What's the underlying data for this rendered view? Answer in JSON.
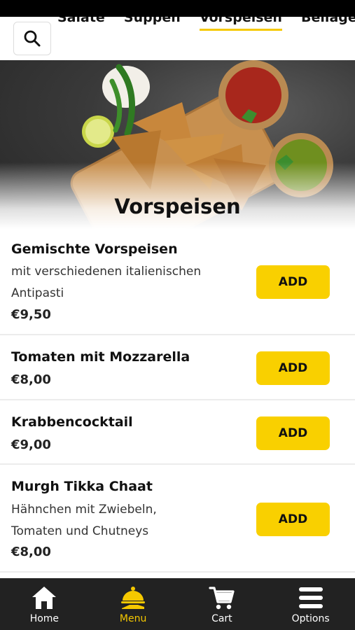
{
  "categories": {
    "tabs": [
      "Salate",
      "Suppen",
      "Vorspeisen",
      "Beilagen und"
    ],
    "active": "Vorspeisen"
  },
  "search": {
    "icon": "search-icon"
  },
  "hero": {
    "title": "Vorspeisen",
    "image": "samosas-with-chutneys"
  },
  "items": [
    {
      "name": "Gemischte Vorspeisen",
      "desc_lines": [
        "mit verschiedenen italienischen",
        "Antipasti"
      ],
      "price": "€9,50",
      "add_label": "ADD"
    },
    {
      "name": "Tomaten mit Mozzarella",
      "desc_lines": [],
      "price": "€8,00",
      "add_label": "ADD"
    },
    {
      "name": "Krabbencocktail",
      "desc_lines": [],
      "price": "€9,00",
      "add_label": "ADD"
    },
    {
      "name": "Murgh Tikka Chaat",
      "desc_lines": [
        "Hähnchen mit Zwiebeln,",
        "Tomaten und Chutneys"
      ],
      "price": "€8,00",
      "add_label": "ADD"
    }
  ],
  "nav": [
    {
      "label": "Home",
      "icon": "home-icon",
      "active": false
    },
    {
      "label": "Menu",
      "icon": "menu-cloche-icon",
      "active": true
    },
    {
      "label": "Cart",
      "icon": "cart-icon",
      "active": false
    },
    {
      "label": "Options",
      "icon": "hamburger-icon",
      "active": false
    }
  ],
  "colors": {
    "accent": "#f9d000",
    "nav_bg": "#222222",
    "active_nav": "#f5c800"
  }
}
